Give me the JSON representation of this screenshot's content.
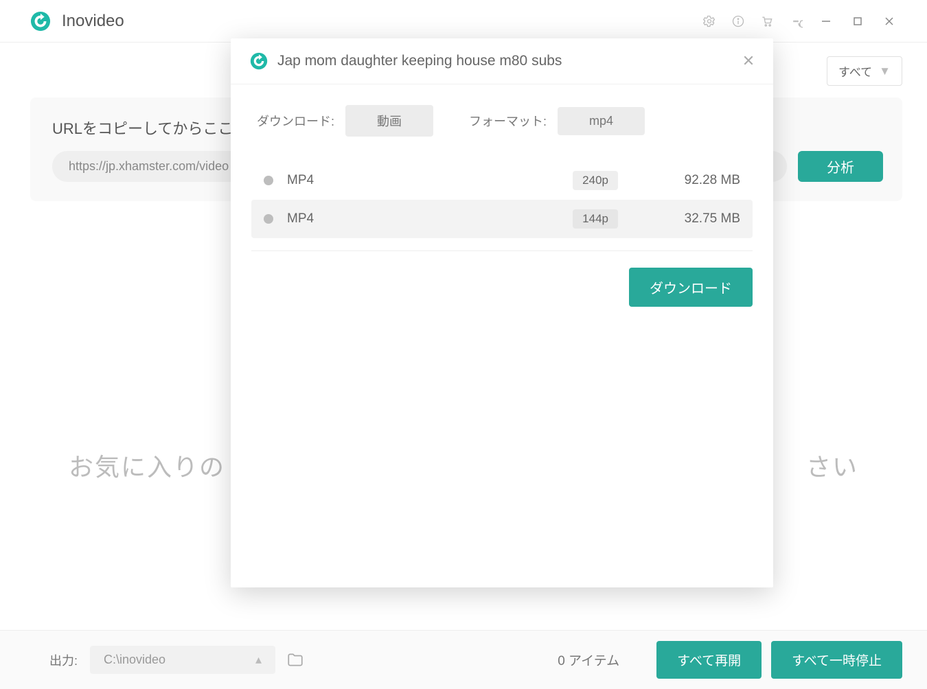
{
  "app": {
    "name": "Inovideo"
  },
  "filter": {
    "label": "すべて"
  },
  "urlcard": {
    "label": "URLをコピーしてからここ",
    "input_value": "https://jp.xhamster.com/video",
    "analyze": "分析"
  },
  "promo": {
    "left": "お気に入りの",
    "right": "さい"
  },
  "bottom": {
    "out_label": "出力:",
    "out_path": "C:\\inovideo",
    "items": "0 アイテム",
    "resume": "すべて再開",
    "pause": "すべて一時停止"
  },
  "modal": {
    "title": "Jap mom daughter keeping house m80 subs",
    "dl_label": "ダウンロード:",
    "dl_value": "動画",
    "fmt_label": "フォーマット:",
    "fmt_value": "mp4",
    "rows": [
      {
        "name": "MP4",
        "res": "240p",
        "size": "92.28 MB"
      },
      {
        "name": "MP4",
        "res": "144p",
        "size": "32.75 MB"
      }
    ],
    "download_btn": "ダウンロード"
  }
}
